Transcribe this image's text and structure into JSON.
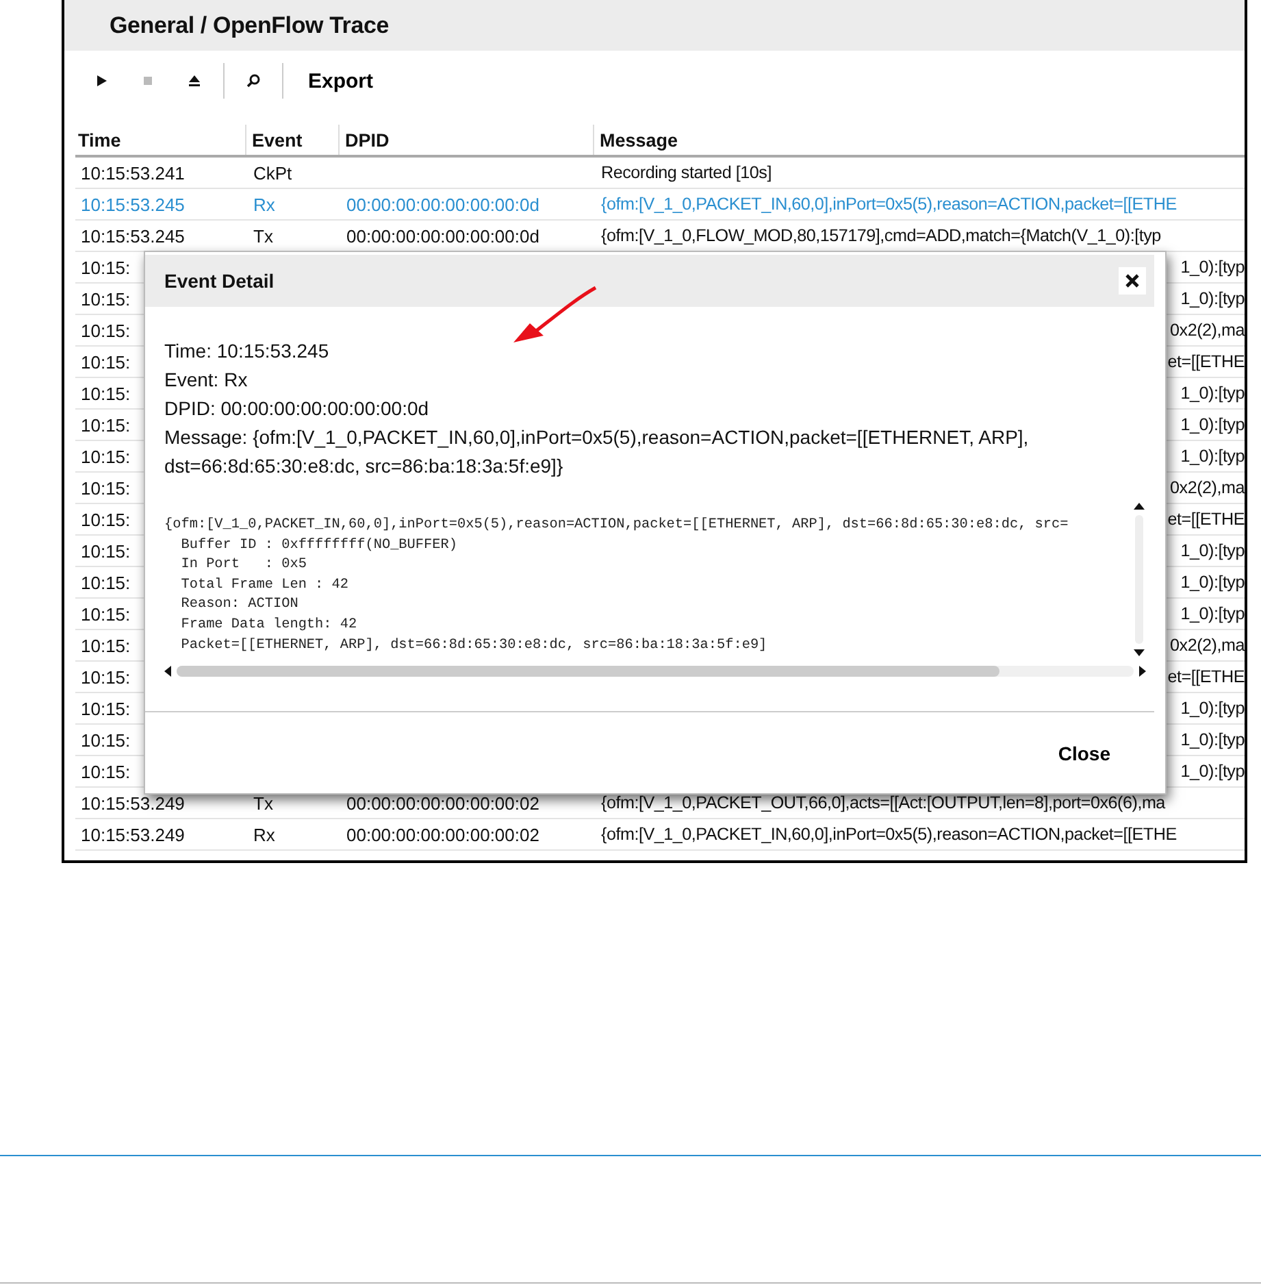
{
  "window": {
    "title": "General / OpenFlow Trace"
  },
  "toolbar": [
    {
      "kind": "play"
    },
    {
      "kind": "stop"
    },
    {
      "kind": "eject"
    },
    {
      "kind": "separator"
    },
    {
      "kind": "search"
    },
    {
      "kind": "separator"
    },
    {
      "kind": "text",
      "label": "Export"
    }
  ],
  "table": {
    "columns": [
      "Time",
      "Event",
      "DPID",
      "Message"
    ],
    "rows": [
      {
        "kind": "full",
        "selected": false,
        "time": "10:15:53.241",
        "event": "CkPt",
        "message": "Recording started [10s]"
      },
      {
        "kind": "full",
        "selected": true,
        "time": "10:15:53.245",
        "event": "Rx",
        "dpid": "00:00:00:00:00:00:00:0d",
        "message": "{ofm:[V_1_0,PACKET_IN,60,0],inPort=0x5(5),reason=ACTION,packet=[[ETHE"
      },
      {
        "kind": "full",
        "selected": false,
        "time": "10:15:53.245",
        "event": "Tx",
        "dpid": "00:00:00:00:00:00:00:0d",
        "message": "{ofm:[V_1_0,FLOW_MOD,80,157179],cmd=ADD,match={Match(V_1_0):[typ"
      },
      {
        "kind": "covered",
        "selected": false,
        "time": "10:15:",
        "message": "1_0):[typ"
      },
      {
        "kind": "covered",
        "selected": false,
        "time": "10:15:",
        "message": "1_0):[typ"
      },
      {
        "kind": "covered",
        "selected": false,
        "time": "10:15:",
        "message": "0x2(2),ma"
      },
      {
        "kind": "covered",
        "selected": false,
        "time": "10:15:",
        "message": "et=[[ETHE"
      },
      {
        "kind": "covered",
        "selected": false,
        "time": "10:15:",
        "message": "1_0):[typ"
      },
      {
        "kind": "covered",
        "selected": false,
        "time": "10:15:",
        "message": "1_0):[typ"
      },
      {
        "kind": "covered",
        "selected": false,
        "time": "10:15:",
        "message": "1_0):[typ"
      },
      {
        "kind": "covered",
        "selected": false,
        "time": "10:15:",
        "message": "0x2(2),ma"
      },
      {
        "kind": "covered",
        "selected": false,
        "time": "10:15:",
        "message": "et=[[ETHE"
      },
      {
        "kind": "covered",
        "selected": false,
        "time": "10:15:",
        "message": "1_0):[typ"
      },
      {
        "kind": "covered",
        "selected": false,
        "time": "10:15:",
        "message": "1_0):[typ"
      },
      {
        "kind": "covered",
        "selected": false,
        "time": "10:15:",
        "message": "1_0):[typ"
      },
      {
        "kind": "covered",
        "selected": false,
        "time": "10:15:",
        "message": "0x2(2),ma"
      },
      {
        "kind": "covered",
        "selected": false,
        "time": "10:15:",
        "message": "et=[[ETHE"
      },
      {
        "kind": "covered",
        "selected": false,
        "time": "10:15:",
        "message": "1_0):[typ"
      },
      {
        "kind": "covered",
        "selected": false,
        "time": "10:15:",
        "message": "1_0):[typ"
      },
      {
        "kind": "covered",
        "selected": false,
        "time": "10:15:",
        "message": "1_0):[typ"
      },
      {
        "kind": "full",
        "selected": false,
        "time": "10:15:53.249",
        "event": "Tx",
        "dpid": "00:00:00:00:00:00:00:02",
        "message": "{ofm:[V_1_0,PACKET_OUT,66,0],acts=[[Act:[OUTPUT,len=8],port=0x6(6),ma"
      },
      {
        "kind": "full",
        "selected": false,
        "time": "10:15:53.249",
        "event": "Rx",
        "dpid": "00:00:00:00:00:00:00:02",
        "message": "{ofm:[V_1_0,PACKET_IN,60,0],inPort=0x5(5),reason=ACTION,packet=[[ETHE"
      }
    ]
  },
  "dialog": {
    "title": "Event Detail",
    "details": [
      "Time: 10:15:53.245",
      "Event: Rx",
      "DPID: 00:00:00:00:00:00:00:0d",
      "Message: {ofm:[V_1_0,PACKET_IN,60,0],inPort=0x5(5),reason=ACTION,packet=[[ETHERNET, ARP], dst=66:8d:65:30:e8:dc, src=86:ba:18:3a:5f:e9]}"
    ],
    "code": [
      "{ofm:[V_1_0,PACKET_IN,60,0],inPort=0x5(5),reason=ACTION,packet=[[ETHERNET, ARP], dst=66:8d:65:30:e8:dc, src=",
      "  Buffer ID : 0xffffffff(NO_BUFFER)",
      "  In Port   : 0x5",
      "  Total Frame Len : 42",
      "  Reason: ACTION",
      "  Frame Data length: 42",
      "  Packet=[[ETHERNET, ARP], dst=66:8d:65:30:e8:dc, src=86:ba:18:3a:5f:e9]"
    ],
    "close": "Close"
  }
}
